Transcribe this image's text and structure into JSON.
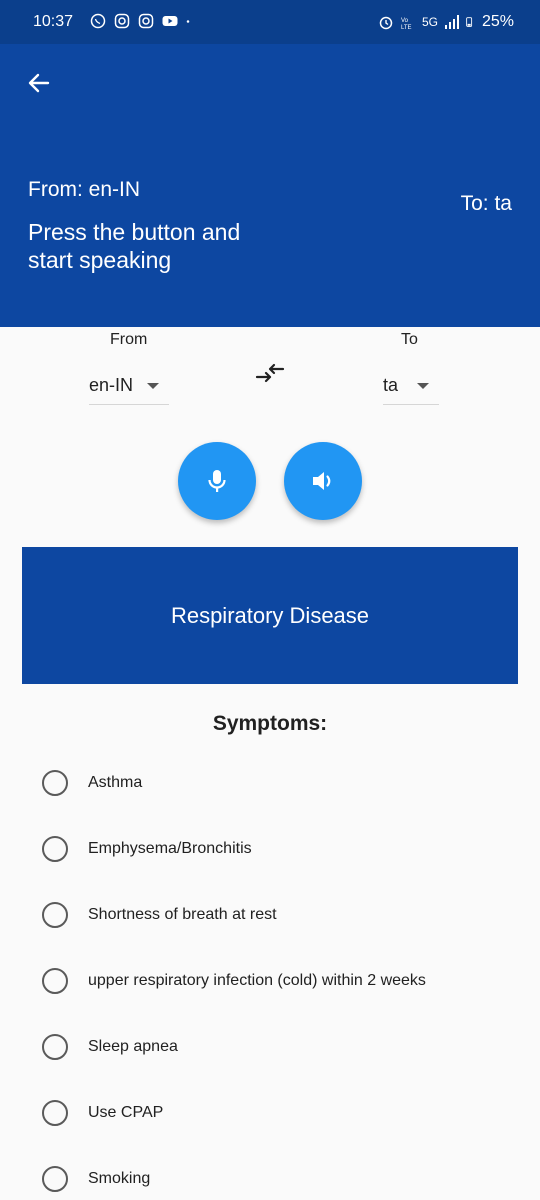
{
  "status_bar": {
    "time": "10:37",
    "left_icons": [
      "whatsapp-icon",
      "instagram-icon",
      "instagram-icon",
      "youtube-icon",
      "dot-icon"
    ],
    "right_icons": [
      "alarm-icon",
      "volte-icon",
      "signal-icon",
      "battery-icon"
    ],
    "network": "5G",
    "battery": "25%"
  },
  "header": {
    "from_text": "From: en-IN",
    "to_text": "To: ta",
    "prompt": "Press the button and start speaking",
    "background": "#0d47a1"
  },
  "selectors": {
    "from_label": "From",
    "to_label": "To",
    "from_value": "en-IN",
    "to_value": "ta"
  },
  "actions": {
    "mic_icon": "mic-icon",
    "speaker_icon": "speaker-icon",
    "swap_icon": "swap-icon",
    "accent": "#2196f3"
  },
  "banner": {
    "title": "Respiratory Disease"
  },
  "symptoms": {
    "title": "Symptoms:",
    "options": [
      "Asthma",
      "Emphysema/Bronchitis",
      "Shortness of breath at rest",
      "upper respiratory infection (cold) within 2 weeks",
      "Sleep apnea",
      "Use CPAP",
      "Smoking"
    ]
  }
}
